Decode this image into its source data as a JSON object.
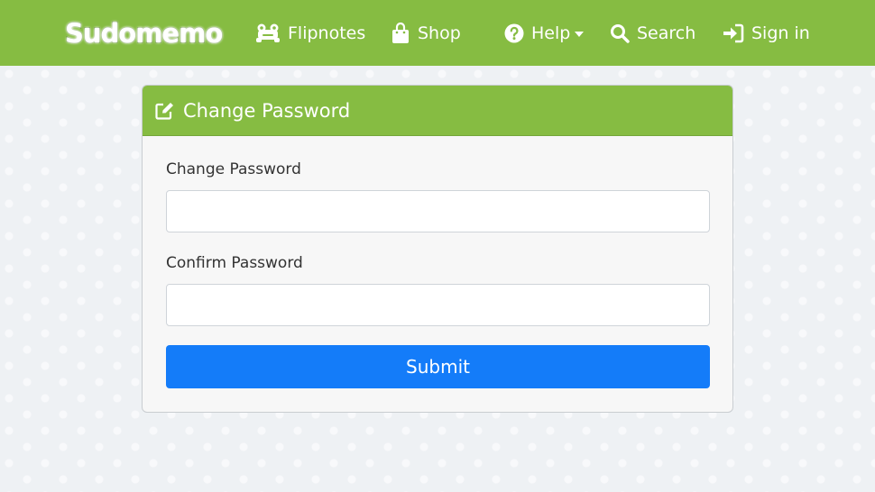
{
  "navbar": {
    "brand": "Sudomemo",
    "items": [
      {
        "label": "Flipnotes",
        "icon": "frog-icon"
      },
      {
        "label": "Shop",
        "icon": "shopping-bag-icon"
      },
      {
        "label": "Help",
        "icon": "question-circle-icon",
        "dropdown": true
      },
      {
        "label": "Search",
        "icon": "search-icon"
      },
      {
        "label": "Sign in",
        "icon": "sign-in-icon"
      }
    ]
  },
  "card": {
    "title": "Change Password",
    "title_icon": "edit-icon",
    "fields": [
      {
        "label": "Change Password",
        "value": "",
        "placeholder": ""
      },
      {
        "label": "Confirm Password",
        "value": "",
        "placeholder": ""
      }
    ],
    "submit_label": "Submit"
  },
  "colors": {
    "navbar": "#86bc42",
    "primary_button": "#147cf9",
    "page_background": "#eef1f4"
  }
}
